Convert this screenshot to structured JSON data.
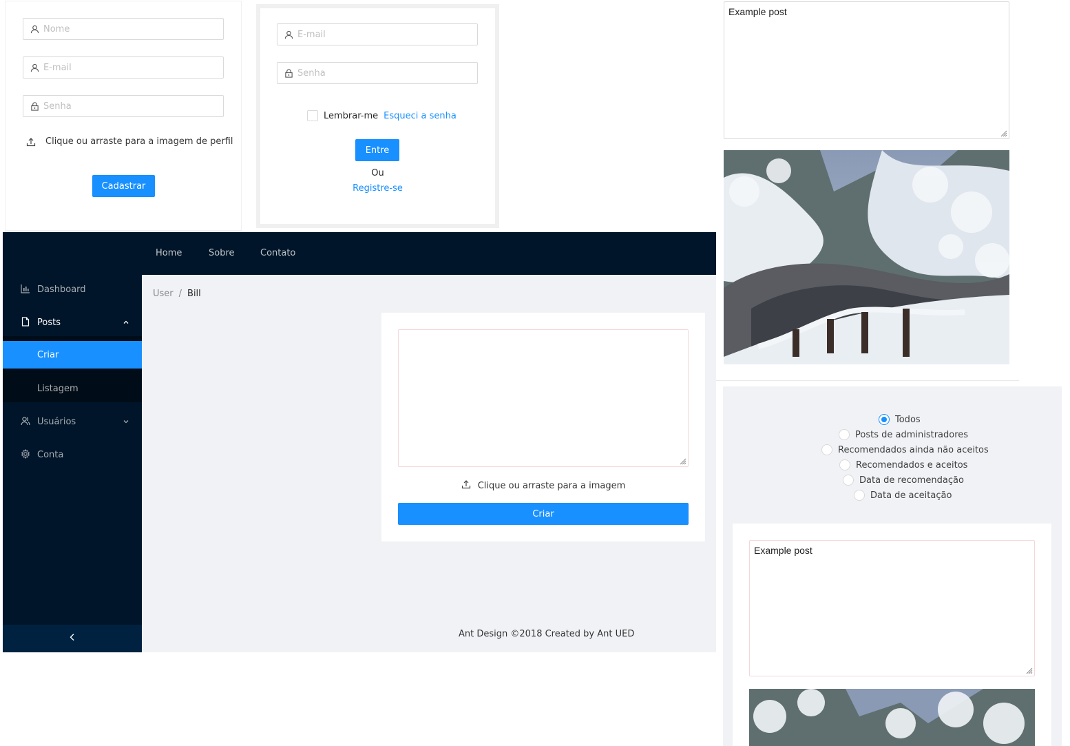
{
  "register_form": {
    "name_placeholder": "Nome",
    "email_placeholder": "E-mail",
    "password_placeholder": "Senha",
    "upload_label": "Clique ou arraste para a imagem de perfil",
    "submit_label": "Cadastrar"
  },
  "login_form": {
    "email_placeholder": "E-mail",
    "password_placeholder": "Senha",
    "remember_label": "Lembrar-me",
    "forgot_label": "Esqueci a senha",
    "submit_label": "Entre",
    "or_label": "Ou",
    "register_link": "Registre-se"
  },
  "header_nav": {
    "items": [
      {
        "label": "Home"
      },
      {
        "label": "Sobre"
      },
      {
        "label": "Contato"
      }
    ]
  },
  "sidebar": {
    "items": [
      {
        "label": "Dashboard",
        "icon": "bar-chart-icon"
      },
      {
        "label": "Posts",
        "icon": "file-icon",
        "expanded": true
      },
      {
        "label": "Criar",
        "selected": true
      },
      {
        "label": "Listagem"
      },
      {
        "label": "Usuários",
        "icon": "users-icon",
        "expanded": false
      },
      {
        "label": "Conta",
        "icon": "gear-icon"
      }
    ],
    "collapse_icon": "chevron-left-icon"
  },
  "breadcrumb": {
    "items": [
      "User",
      "Bill"
    ],
    "separator": "/"
  },
  "create_post": {
    "textarea_value": "",
    "upload_label": "Clique ou arraste para a imagem",
    "submit_label": "Criar"
  },
  "footer": {
    "text": "Ant Design ©2018 Created by Ant UED"
  },
  "post_preview": {
    "text": "Example post"
  },
  "filter": {
    "options": [
      {
        "label": "Todos",
        "checked": true
      },
      {
        "label": "Posts de administradores",
        "checked": false
      },
      {
        "label": "Recomendados ainda não aceitos",
        "checked": false
      },
      {
        "label": "Recomendados e aceitos",
        "checked": false
      },
      {
        "label": "Data de recomendação",
        "checked": false
      },
      {
        "label": "Data de aceitação",
        "checked": false
      }
    ]
  },
  "post_list": {
    "items": [
      {
        "text": "Example post"
      }
    ]
  },
  "colors": {
    "primary": "#1890ff",
    "sider_bg": "#001529",
    "content_bg": "#f0f2f5"
  }
}
